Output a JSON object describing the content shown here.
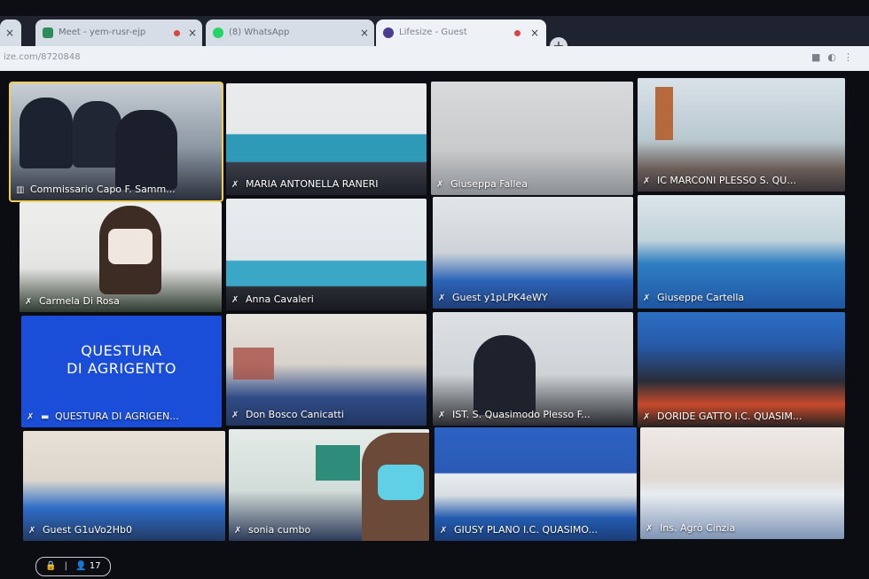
{
  "browser": {
    "tabs": [
      {
        "title": "Meet - yem-rusr-ejp",
        "color": "#2d8c5c"
      },
      {
        "title": "(8) WhatsApp",
        "color": "#25d366"
      },
      {
        "title": "Lifesize - Guest",
        "color": "#4d3b8f"
      }
    ],
    "url": "ize.com/8720848"
  },
  "meeting": {
    "participants_count": "17",
    "tiles": [
      {
        "name": "Commissario Capo F. Samm..."
      },
      {
        "name": "MARIA ANTONELLA RANERI"
      },
      {
        "name": "Giuseppa Fallea"
      },
      {
        "name": "IC MARCONI PLESSO S. QU..."
      },
      {
        "name": "Carmela Di Rosa"
      },
      {
        "name": "Anna Cavaleri"
      },
      {
        "name": "Guest y1pLPK4eWY"
      },
      {
        "name": "Giuseppe Cartella"
      },
      {
        "name": "QUESTURA DI AGRIGEN...",
        "card_line1": "QUESTURA",
        "card_line2": "DI AGRIGENTO"
      },
      {
        "name": "Don Bosco Canicatti"
      },
      {
        "name": "IST. S. Quasimodo Plesso F..."
      },
      {
        "name": "DORIDE GATTO I.C. QUASIM..."
      },
      {
        "name": "Guest G1uVo2Hb0"
      },
      {
        "name": "sonia cumbo"
      },
      {
        "name": "GIUSY PLANO I.C. QUASIMO..."
      },
      {
        "name": "Ins. Agrò Cinzia"
      }
    ]
  },
  "icons": {
    "mic_muted": "mic-off-icon",
    "lock": "lock-icon",
    "people": "people-icon"
  }
}
